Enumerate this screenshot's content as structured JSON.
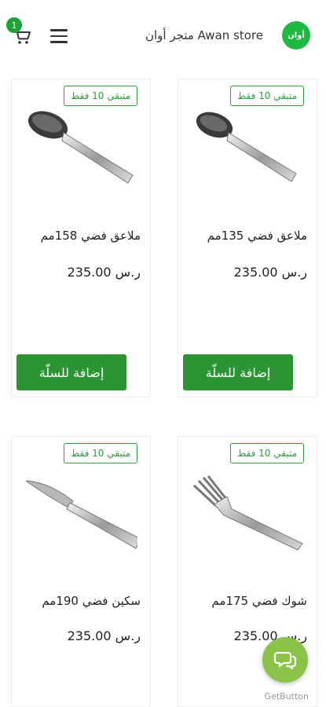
{
  "header": {
    "store_name": "متجر أوان Awan store",
    "logo_text": "أوان",
    "cart_count": "1"
  },
  "colors": {
    "brand_green": "#2a9532",
    "logo_green": "#1fb843",
    "chat_green": "#8bc34a"
  },
  "products": [
    {
      "title": "ملاعق فضي 135مم",
      "price": "235.00 ر.س",
      "stock": "متبقي 10 فقط",
      "button": "إضافة للسلّة",
      "icon": "spoon-icon"
    },
    {
      "title": "ملاعق فضي 158مم",
      "price": "235.00 ر.س",
      "stock": "متبقي 10 فقط",
      "button": "إضافة للسلّة",
      "icon": "spoon-icon"
    },
    {
      "title": "شوك فضي 175مم",
      "price": "235.00 ر.س",
      "stock": "متبقي 10 فقط",
      "icon": "fork-icon"
    },
    {
      "title": "سكين فضي 190مم",
      "price": "235.00 ر.س",
      "stock": "متبقي 10 فقط",
      "icon": "knife-icon"
    }
  ],
  "widget": {
    "label": "GetButton",
    "icon": "chat-icon"
  }
}
